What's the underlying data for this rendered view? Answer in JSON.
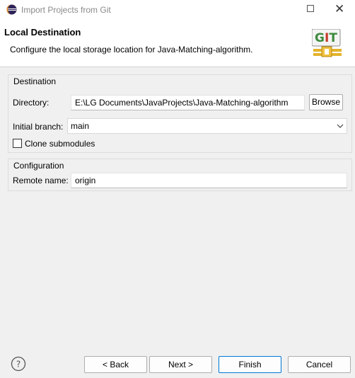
{
  "window": {
    "title": "Import Projects from Git"
  },
  "banner": {
    "title": "Local Destination",
    "description": "Configure the local storage location for Java-Matching-algorithm.",
    "logo_text": "GIT"
  },
  "destination": {
    "group_label": "Destination",
    "directory_label": "Directory:",
    "directory_value": "E:\\LG Documents\\JavaProjects\\Java-Matching-algorithm",
    "browse_label": "Browse",
    "branch_label": "Initial branch:",
    "branch_value": "main",
    "clone_submodules_label": "Clone submodules",
    "clone_submodules_checked": false
  },
  "configuration": {
    "group_label": "Configuration",
    "remote_name_label": "Remote name:",
    "remote_name_value": "origin"
  },
  "footer": {
    "back_label": "< Back",
    "next_label": "Next >",
    "finish_label": "Finish",
    "cancel_label": "Cancel"
  },
  "colors": {
    "accent": "#0078d7",
    "logo_green": "#3c8a3c",
    "logo_red": "#c43a2a"
  }
}
